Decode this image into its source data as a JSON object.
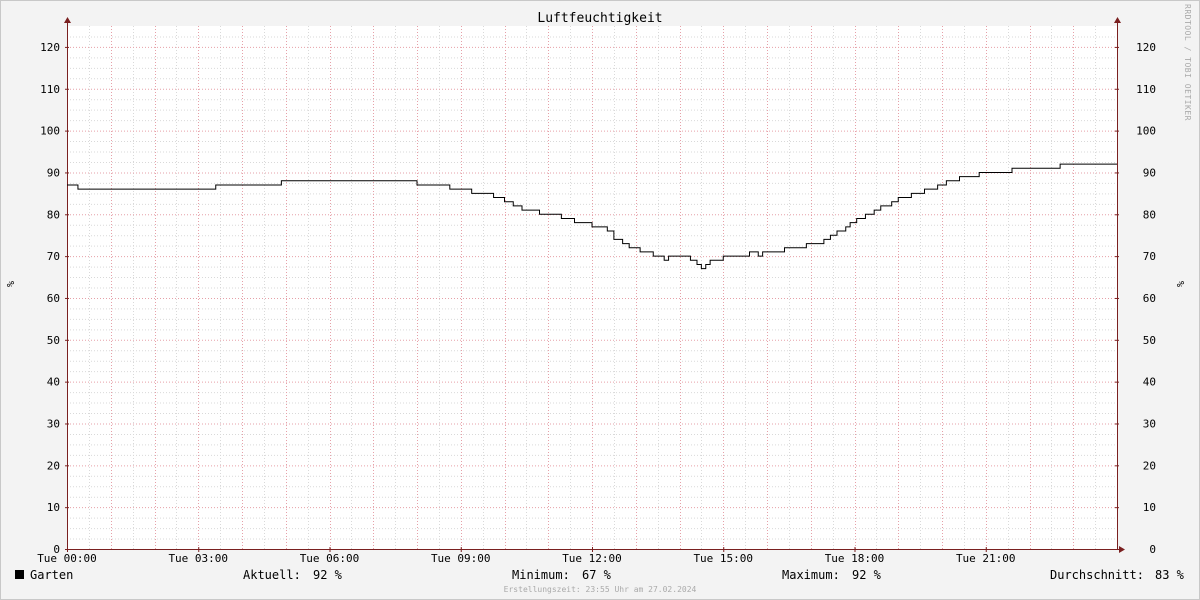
{
  "chart_data": {
    "type": "line",
    "title": "Luftfeuchtigkeit",
    "ylabel": "%",
    "ylabel_right": "%",
    "ylim": [
      0,
      125
    ],
    "xlim": [
      0,
      24
    ],
    "y_ticks": [
      0,
      10,
      20,
      30,
      40,
      50,
      60,
      70,
      80,
      90,
      100,
      110,
      120
    ],
    "x_ticks": [
      {
        "x": 0,
        "label": "Tue 00:00"
      },
      {
        "x": 3,
        "label": "Tue 03:00"
      },
      {
        "x": 6,
        "label": "Tue 06:00"
      },
      {
        "x": 9,
        "label": "Tue 09:00"
      },
      {
        "x": 12,
        "label": "Tue 12:00"
      },
      {
        "x": 15,
        "label": "Tue 15:00"
      },
      {
        "x": 18,
        "label": "Tue 18:00"
      },
      {
        "x": 21,
        "label": "Tue 21:00"
      }
    ],
    "grid": true,
    "series": [
      {
        "name": "Garten",
        "color": "#000000",
        "x_unit": "hours",
        "points": [
          [
            0.0,
            87
          ],
          [
            0.25,
            86
          ],
          [
            3.4,
            87
          ],
          [
            4.9,
            88
          ],
          [
            8.0,
            87
          ],
          [
            8.75,
            86
          ],
          [
            9.25,
            85
          ],
          [
            9.75,
            84
          ],
          [
            10.0,
            83
          ],
          [
            10.2,
            82
          ],
          [
            10.4,
            81
          ],
          [
            10.8,
            80
          ],
          [
            11.3,
            79
          ],
          [
            11.6,
            78
          ],
          [
            12.0,
            77
          ],
          [
            12.35,
            76
          ],
          [
            12.5,
            74
          ],
          [
            12.7,
            73
          ],
          [
            12.85,
            72
          ],
          [
            13.1,
            71
          ],
          [
            13.4,
            70
          ],
          [
            13.65,
            69
          ],
          [
            13.75,
            70
          ],
          [
            14.25,
            69
          ],
          [
            14.4,
            68
          ],
          [
            14.5,
            67
          ],
          [
            14.6,
            68
          ],
          [
            14.7,
            69
          ],
          [
            15.0,
            70
          ],
          [
            15.6,
            71
          ],
          [
            15.8,
            70
          ],
          [
            15.9,
            71
          ],
          [
            16.4,
            72
          ],
          [
            16.9,
            73
          ],
          [
            17.3,
            74
          ],
          [
            17.45,
            75
          ],
          [
            17.6,
            76
          ],
          [
            17.8,
            77
          ],
          [
            17.9,
            78
          ],
          [
            18.05,
            79
          ],
          [
            18.25,
            80
          ],
          [
            18.45,
            81
          ],
          [
            18.6,
            82
          ],
          [
            18.85,
            83
          ],
          [
            19.0,
            84
          ],
          [
            19.3,
            85
          ],
          [
            19.6,
            86
          ],
          [
            19.9,
            87
          ],
          [
            20.1,
            88
          ],
          [
            20.4,
            89
          ],
          [
            20.85,
            90
          ],
          [
            21.6,
            91
          ],
          [
            22.7,
            92
          ],
          [
            24.0,
            92
          ]
        ]
      }
    ],
    "legend": {
      "series_name": "Garten",
      "current_label": "Aktuell:",
      "current_value": "92 %",
      "min_label": "Minimum:",
      "min_value": "67 %",
      "max_label": "Maximum:",
      "max_value": "92 %",
      "avg_label": "Durchschnitt:",
      "avg_value": "83 %"
    }
  },
  "watermark": "RRDTOOL / TOBI OETIKER",
  "footer": "Erstellungszeit: 23:55 Uhr am 27.02.2024",
  "colors": {
    "background": "#f3f3f3",
    "canvas": "#ffffff",
    "minor_grid": "#d9d9d9",
    "major_grid": "#e6a0a8",
    "axis": "#7a2020",
    "line": "#000000"
  }
}
